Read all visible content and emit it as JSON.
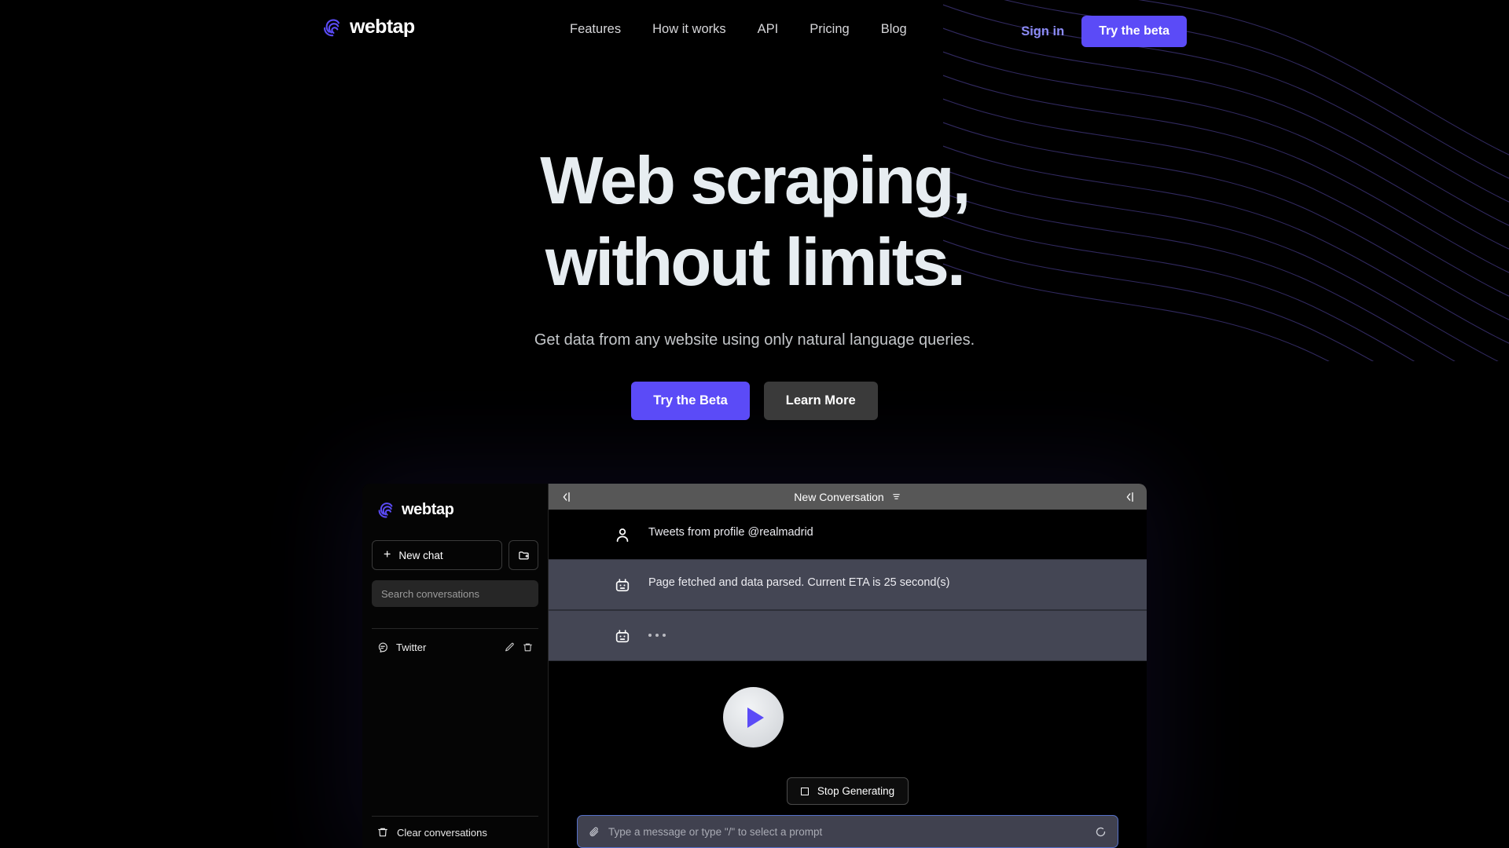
{
  "brand": {
    "name": "webtap",
    "logo_icon": "spiral-logo-icon",
    "accent": "#5B4BF7"
  },
  "nav": {
    "links": [
      {
        "label": "Features"
      },
      {
        "label": "How it works"
      },
      {
        "label": "API"
      },
      {
        "label": "Pricing"
      },
      {
        "label": "Blog"
      }
    ],
    "sign_in": "Sign in",
    "cta": "Try the beta"
  },
  "hero": {
    "title_line1": "Web scraping,",
    "title_line2": "without limits.",
    "subtitle": "Get data from any website using only natural language queries.",
    "primary_cta": "Try the Beta",
    "secondary_cta": "Learn More"
  },
  "app": {
    "sidebar": {
      "brand": "webtap",
      "new_chat": "New chat",
      "new_folder_icon": "folder-plus-icon",
      "search_placeholder": "Search conversations",
      "search_value": "",
      "conversations": [
        {
          "label": "Twitter",
          "icon": "chat-bubble-icon",
          "edit_icon": "pencil-icon",
          "delete_icon": "trash-icon"
        }
      ],
      "clear_conversations": "Clear conversations",
      "clear_icon": "trash-icon"
    },
    "header": {
      "title": "New Conversation",
      "menu_icon": "hamburger-icon",
      "collapse_left_icon": "arrow-left-collapse-icon",
      "collapse_right_icon": "arrow-left-collapse-icon"
    },
    "messages": [
      {
        "role": "user",
        "avatar_icon": "person-icon",
        "text": "Tweets from profile @realmadrid"
      },
      {
        "role": "bot",
        "avatar_icon": "robot-icon",
        "text": "Page fetched and data parsed. Current ETA is 25 second(s)"
      },
      {
        "role": "bot",
        "avatar_icon": "robot-icon",
        "text": "",
        "typing": true
      }
    ],
    "stop_generating": "Stop Generating",
    "stop_icon": "stop-square-icon",
    "composer_placeholder": "Type a message or type \"/\" to select a prompt",
    "composer_value": "",
    "composer_attach_icon": "attachment-icon",
    "composer_spinner_icon": "spinner-icon"
  },
  "overlay": {
    "play_icon": "play-triangle-icon"
  }
}
